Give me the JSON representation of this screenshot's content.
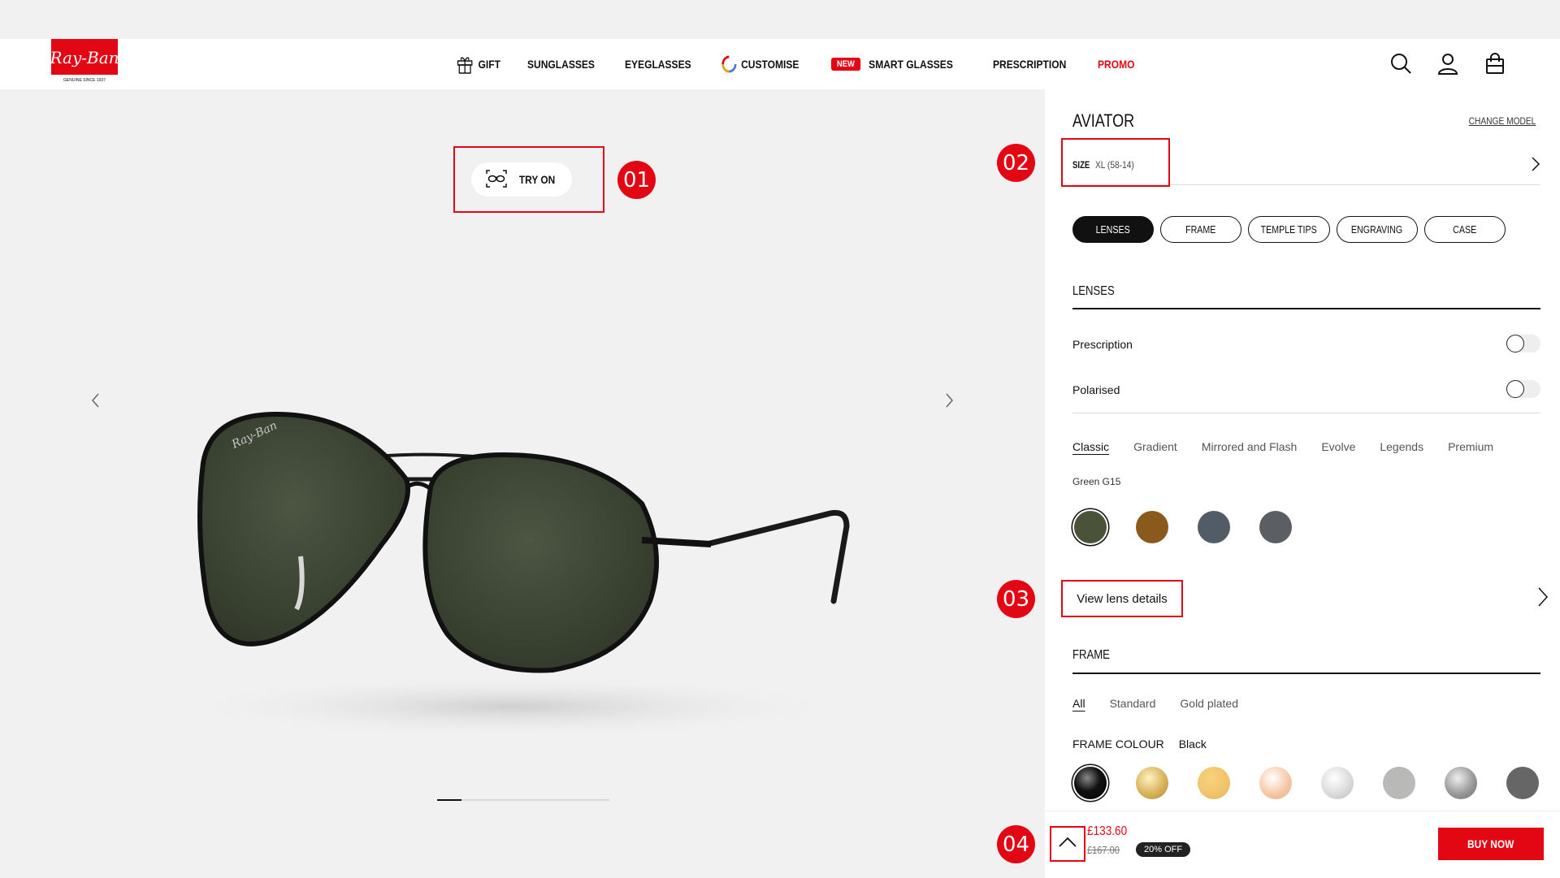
{
  "brand": {
    "logo_text": "Ray-Ban",
    "logo_tagline": "GENUINE SINCE 1937",
    "color": "#e30613"
  },
  "nav": {
    "gift": "GIFT",
    "sunglasses": "SUNGLASSES",
    "eyeglasses": "EYEGLASSES",
    "customise": "CUSTOMISE",
    "new_badge": "NEW",
    "smart_glasses": "SMART GLASSES",
    "prescription": "PRESCRIPTION",
    "promo": "PROMO"
  },
  "product_view": {
    "try_on": "TRY ON"
  },
  "markers": {
    "m1": "01",
    "m2": "02",
    "m3": "03",
    "m4": "04"
  },
  "panel": {
    "model": "AVIATOR",
    "change_model": "CHANGE MODEL",
    "size_label": "SIZE",
    "size_value": "XL (58-14)",
    "tabs": [
      "LENSES",
      "FRAME",
      "TEMPLE TIPS",
      "ENGRAVING",
      "CASE"
    ],
    "lenses_title": "LENSES",
    "prescription": "Prescription",
    "polarised": "Polarised",
    "lens_filters": [
      "Classic",
      "Gradient",
      "Mirrored and Flash",
      "Evolve",
      "Legends",
      "Premium"
    ],
    "selected_lens": "Green G15",
    "lens_swatches": [
      "#4a5238",
      "#8a5a1c",
      "#525c66",
      "#5b5e62"
    ],
    "view_lens_details": "View lens details",
    "frame_title": "FRAME",
    "frame_filters": [
      "All",
      "Standard",
      "Gold plated"
    ],
    "frame_colour_label": "FRAME COLOUR",
    "frame_colour_value": "Black",
    "frame_swatches": [
      "black-chrome",
      "gold-gradient",
      "yellow-gold",
      "rose-gold",
      "silver",
      "grey",
      "gunmetal",
      "dark-grey"
    ],
    "price": "£133.60",
    "old_price": "£167.00",
    "discount": "20% OFF",
    "buy_now": "BUY NOW"
  }
}
